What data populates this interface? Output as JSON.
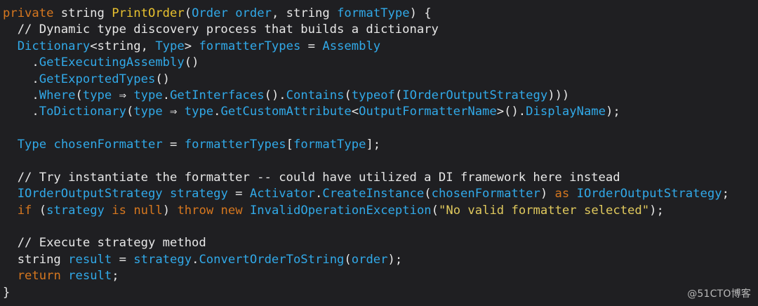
{
  "colors": {
    "background": "#1f1f22",
    "default_text": "#e7e7e7",
    "keyword": "#d6771f",
    "member_or_type_ref": "#31a9e8",
    "string": "#e0c95d",
    "method_declaration": "#e8c12f"
  },
  "watermark": "@51CTO博客",
  "lines": [
    [
      {
        "t": "private",
        "k": "keyword"
      },
      {
        "t": " string ",
        "k": "ident"
      },
      {
        "t": "PrintOrder",
        "k": "decl"
      },
      {
        "t": "(",
        "k": "punct"
      },
      {
        "t": "Order",
        "k": "classname"
      },
      {
        "t": " ",
        "k": "ident"
      },
      {
        "t": "order",
        "k": "param"
      },
      {
        "t": ", string ",
        "k": "ident"
      },
      {
        "t": "formatType",
        "k": "param"
      },
      {
        "t": ") {",
        "k": "punct"
      }
    ],
    [
      {
        "t": "  // Dynamic type discovery process that builds a dictionary",
        "k": "comment"
      }
    ],
    [
      {
        "t": "  ",
        "k": "ident"
      },
      {
        "t": "Dictionary",
        "k": "classname"
      },
      {
        "t": "<string, ",
        "k": "ident"
      },
      {
        "t": "Type",
        "k": "classname"
      },
      {
        "t": "> ",
        "k": "ident"
      },
      {
        "t": "formatterTypes",
        "k": "param"
      },
      {
        "t": " = ",
        "k": "ident"
      },
      {
        "t": "Assembly",
        "k": "classname"
      }
    ],
    [
      {
        "t": "    .",
        "k": "punct"
      },
      {
        "t": "GetExecutingAssembly",
        "k": "method"
      },
      {
        "t": "()",
        "k": "punct"
      }
    ],
    [
      {
        "t": "    .",
        "k": "punct"
      },
      {
        "t": "GetExportedTypes",
        "k": "method"
      },
      {
        "t": "()",
        "k": "punct"
      }
    ],
    [
      {
        "t": "    .",
        "k": "punct"
      },
      {
        "t": "Where",
        "k": "method"
      },
      {
        "t": "(",
        "k": "punct"
      },
      {
        "t": "type",
        "k": "param"
      },
      {
        "t": " ⇒ ",
        "k": "ident"
      },
      {
        "t": "type",
        "k": "param"
      },
      {
        "t": ".",
        "k": "punct"
      },
      {
        "t": "GetInterfaces",
        "k": "method"
      },
      {
        "t": "().",
        "k": "punct"
      },
      {
        "t": "Contains",
        "k": "method"
      },
      {
        "t": "(",
        "k": "punct"
      },
      {
        "t": "typeof",
        "k": "method"
      },
      {
        "t": "(",
        "k": "punct"
      },
      {
        "t": "IOrderOutputStrategy",
        "k": "classname"
      },
      {
        "t": ")))",
        "k": "punct"
      }
    ],
    [
      {
        "t": "    .",
        "k": "punct"
      },
      {
        "t": "ToDictionary",
        "k": "method"
      },
      {
        "t": "(",
        "k": "punct"
      },
      {
        "t": "type",
        "k": "param"
      },
      {
        "t": " ⇒ ",
        "k": "ident"
      },
      {
        "t": "type",
        "k": "param"
      },
      {
        "t": ".",
        "k": "punct"
      },
      {
        "t": "GetCustomAttribute",
        "k": "method"
      },
      {
        "t": "<",
        "k": "punct"
      },
      {
        "t": "OutputFormatterName",
        "k": "classname"
      },
      {
        "t": ">().",
        "k": "punct"
      },
      {
        "t": "DisplayName",
        "k": "method"
      },
      {
        "t": ");",
        "k": "punct"
      }
    ],
    [
      {
        "t": "",
        "k": "ident"
      }
    ],
    [
      {
        "t": "  ",
        "k": "ident"
      },
      {
        "t": "Type",
        "k": "classname"
      },
      {
        "t": " ",
        "k": "ident"
      },
      {
        "t": "chosenFormatter",
        "k": "param"
      },
      {
        "t": " = ",
        "k": "ident"
      },
      {
        "t": "formatterTypes",
        "k": "param"
      },
      {
        "t": "[",
        "k": "punct"
      },
      {
        "t": "formatType",
        "k": "param"
      },
      {
        "t": "];",
        "k": "punct"
      }
    ],
    [
      {
        "t": "",
        "k": "ident"
      }
    ],
    [
      {
        "t": "  // Try instantiate the formatter -- could have utilized a DI framework here instead",
        "k": "comment"
      }
    ],
    [
      {
        "t": "  ",
        "k": "ident"
      },
      {
        "t": "IOrderOutputStrategy",
        "k": "classname"
      },
      {
        "t": " ",
        "k": "ident"
      },
      {
        "t": "strategy",
        "k": "param"
      },
      {
        "t": " = ",
        "k": "ident"
      },
      {
        "t": "Activator",
        "k": "classname"
      },
      {
        "t": ".",
        "k": "punct"
      },
      {
        "t": "CreateInstance",
        "k": "method"
      },
      {
        "t": "(",
        "k": "punct"
      },
      {
        "t": "chosenFormatter",
        "k": "param"
      },
      {
        "t": ") ",
        "k": "punct"
      },
      {
        "t": "as",
        "k": "keyword"
      },
      {
        "t": " ",
        "k": "ident"
      },
      {
        "t": "IOrderOutputStrategy",
        "k": "classname"
      },
      {
        "t": ";",
        "k": "punct"
      }
    ],
    [
      {
        "t": "  ",
        "k": "ident"
      },
      {
        "t": "if",
        "k": "keyword"
      },
      {
        "t": " (",
        "k": "punct"
      },
      {
        "t": "strategy",
        "k": "param"
      },
      {
        "t": " ",
        "k": "ident"
      },
      {
        "t": "is",
        "k": "keyword"
      },
      {
        "t": " ",
        "k": "ident"
      },
      {
        "t": "null",
        "k": "keyword"
      },
      {
        "t": ") ",
        "k": "punct"
      },
      {
        "t": "throw",
        "k": "keyword"
      },
      {
        "t": " ",
        "k": "ident"
      },
      {
        "t": "new",
        "k": "keyword"
      },
      {
        "t": " ",
        "k": "ident"
      },
      {
        "t": "InvalidOperationException",
        "k": "classname"
      },
      {
        "t": "(",
        "k": "punct"
      },
      {
        "t": "\"No valid formatter selected\"",
        "k": "string"
      },
      {
        "t": ");",
        "k": "punct"
      }
    ],
    [
      {
        "t": "",
        "k": "ident"
      }
    ],
    [
      {
        "t": "  // Execute strategy method",
        "k": "comment"
      }
    ],
    [
      {
        "t": "  string ",
        "k": "ident"
      },
      {
        "t": "result",
        "k": "param"
      },
      {
        "t": " = ",
        "k": "ident"
      },
      {
        "t": "strategy",
        "k": "param"
      },
      {
        "t": ".",
        "k": "punct"
      },
      {
        "t": "ConvertOrderToString",
        "k": "method"
      },
      {
        "t": "(",
        "k": "punct"
      },
      {
        "t": "order",
        "k": "param"
      },
      {
        "t": ");",
        "k": "punct"
      }
    ],
    [
      {
        "t": "  ",
        "k": "ident"
      },
      {
        "t": "return",
        "k": "keyword"
      },
      {
        "t": " ",
        "k": "ident"
      },
      {
        "t": "result",
        "k": "param"
      },
      {
        "t": ";",
        "k": "punct"
      }
    ],
    [
      {
        "t": "}",
        "k": "punct"
      }
    ]
  ]
}
